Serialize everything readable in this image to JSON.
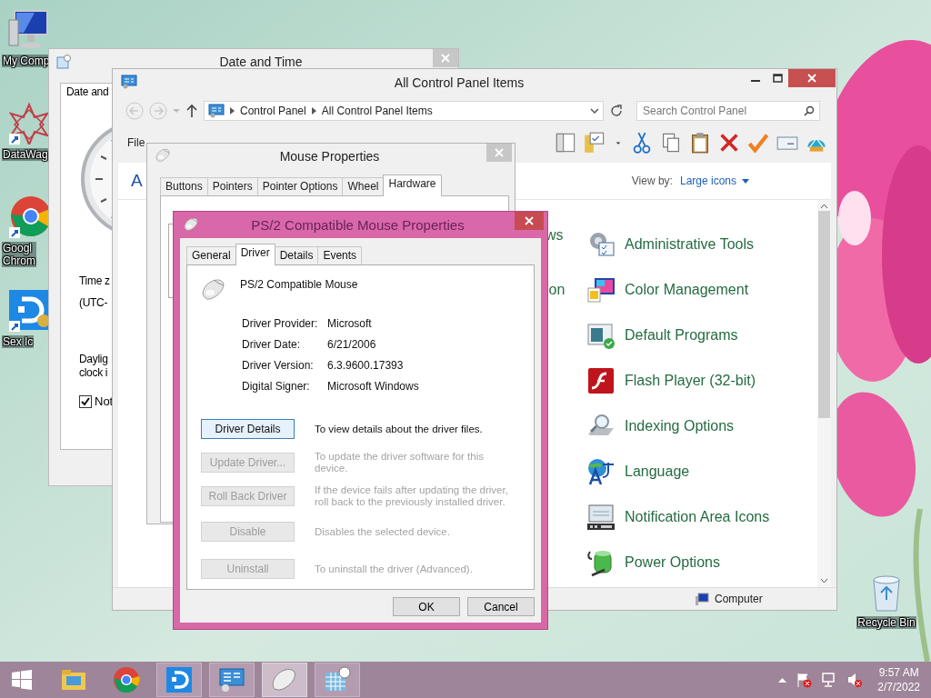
{
  "desktop_icons": [
    {
      "kind": "computer",
      "lines": [
        "My Comp"
      ]
    },
    {
      "kind": "datawag",
      "lines": [
        "DataWag"
      ]
    },
    {
      "kind": "chrome",
      "lines": [
        "Googl",
        "Chrom"
      ]
    },
    {
      "kind": "app",
      "lines": [
        "Sex Ic"
      ]
    }
  ],
  "recycle_bin": {
    "label": "Recycle Bin"
  },
  "date_time_window": {
    "title": "Date and Time",
    "tab": "Date and",
    "texts": [
      "Time z",
      "(UTC-"
    ],
    "dst_lines": [
      "Daylig",
      "clock i"
    ],
    "checkbox": {
      "label": "Not",
      "checked": true
    }
  },
  "control_panel": {
    "title": "All Control Panel Items",
    "breadcrumb": [
      "Control Panel",
      "All Control Panel Items"
    ],
    "search": {
      "placeholder": "Search Control Panel"
    },
    "menu": [
      "File"
    ],
    "heading": "A",
    "view_by_label": "View by:",
    "view_by_value": "Large icons",
    "left_fragments": [
      "ws",
      "ion"
    ],
    "items": [
      {
        "kind": "admin",
        "label": "Administrative Tools"
      },
      {
        "kind": "color",
        "label": "Color Management"
      },
      {
        "kind": "default",
        "label": "Default Programs"
      },
      {
        "kind": "flash",
        "label": "Flash Player (32-bit)"
      },
      {
        "kind": "indexing",
        "label": "Indexing Options"
      },
      {
        "kind": "language",
        "label": "Language"
      },
      {
        "kind": "notification",
        "label": "Notification Area Icons"
      },
      {
        "kind": "power",
        "label": "Power Options"
      }
    ],
    "status": "Computer"
  },
  "mouse_properties": {
    "title": "Mouse Properties",
    "tabs": [
      {
        "label": "Buttons",
        "selected": false
      },
      {
        "label": "Pointers",
        "selected": false
      },
      {
        "label": "Pointer Options",
        "selected": false
      },
      {
        "label": "Wheel",
        "selected": false
      },
      {
        "label": "Hardware",
        "selected": true
      }
    ]
  },
  "ps2_dialog": {
    "title": "PS/2 Compatible Mouse Properties",
    "tabs": [
      {
        "label": "General",
        "selected": false
      },
      {
        "label": "Driver",
        "selected": true
      },
      {
        "label": "Details",
        "selected": false
      },
      {
        "label": "Events",
        "selected": false
      }
    ],
    "device_name": "PS/2 Compatible Mouse",
    "properties": [
      {
        "label": "Driver Provider:",
        "value": "Microsoft"
      },
      {
        "label": "Driver Date:",
        "value": "6/21/2006"
      },
      {
        "label": "Driver Version:",
        "value": "6.3.9600.17393"
      },
      {
        "label": "Digital Signer:",
        "value": "Microsoft Windows"
      }
    ],
    "actions": [
      {
        "button": "Driver Details",
        "description": "To view details about the driver files.",
        "disabled": false
      },
      {
        "button": "Update Driver...",
        "description": "To update the driver software for this device.",
        "disabled": true
      },
      {
        "button": "Roll Back Driver",
        "description": "If the device fails after updating the driver, roll back to the previously installed driver.",
        "disabled": true
      },
      {
        "button": "Disable",
        "description": "Disables the selected device.",
        "disabled": true
      },
      {
        "button": "Uninstall",
        "description": "To uninstall the driver (Advanced).",
        "disabled": true
      }
    ],
    "buttons": [
      "OK",
      "Cancel"
    ]
  },
  "taskbar": {
    "apps": [
      {
        "kind": "explorer",
        "open": false,
        "selected": false
      },
      {
        "kind": "chrome",
        "open": false,
        "selected": false
      },
      {
        "kind": "app",
        "open": true,
        "selected": false
      },
      {
        "kind": "control-panel",
        "open": true,
        "selected": false
      },
      {
        "kind": "mouse",
        "open": true,
        "selected": true
      },
      {
        "kind": "clock",
        "open": true,
        "selected": false
      }
    ],
    "time": "9:57 AM",
    "date": "2/7/2022"
  }
}
